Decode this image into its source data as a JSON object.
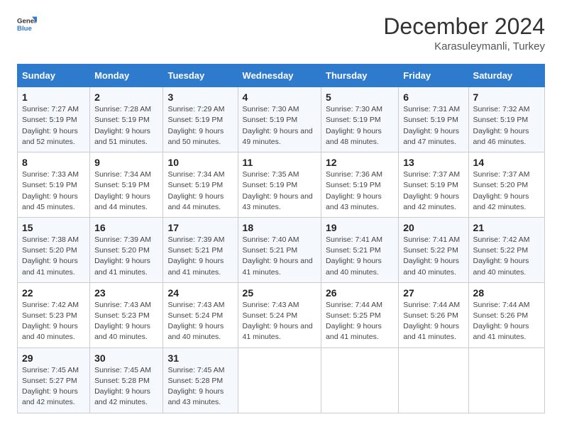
{
  "logo": {
    "general": "General",
    "blue": "Blue"
  },
  "title": "December 2024",
  "subtitle": "Karasuleymanli, Turkey",
  "days_header": [
    "Sunday",
    "Monday",
    "Tuesday",
    "Wednesday",
    "Thursday",
    "Friday",
    "Saturday"
  ],
  "weeks": [
    [
      {
        "day": "1",
        "sunrise": "7:27 AM",
        "sunset": "5:19 PM",
        "daylight": "9 hours and 52 minutes."
      },
      {
        "day": "2",
        "sunrise": "7:28 AM",
        "sunset": "5:19 PM",
        "daylight": "9 hours and 51 minutes."
      },
      {
        "day": "3",
        "sunrise": "7:29 AM",
        "sunset": "5:19 PM",
        "daylight": "9 hours and 50 minutes."
      },
      {
        "day": "4",
        "sunrise": "7:30 AM",
        "sunset": "5:19 PM",
        "daylight": "9 hours and 49 minutes."
      },
      {
        "day": "5",
        "sunrise": "7:30 AM",
        "sunset": "5:19 PM",
        "daylight": "9 hours and 48 minutes."
      },
      {
        "day": "6",
        "sunrise": "7:31 AM",
        "sunset": "5:19 PM",
        "daylight": "9 hours and 47 minutes."
      },
      {
        "day": "7",
        "sunrise": "7:32 AM",
        "sunset": "5:19 PM",
        "daylight": "9 hours and 46 minutes."
      }
    ],
    [
      {
        "day": "8",
        "sunrise": "7:33 AM",
        "sunset": "5:19 PM",
        "daylight": "9 hours and 45 minutes."
      },
      {
        "day": "9",
        "sunrise": "7:34 AM",
        "sunset": "5:19 PM",
        "daylight": "9 hours and 44 minutes."
      },
      {
        "day": "10",
        "sunrise": "7:34 AM",
        "sunset": "5:19 PM",
        "daylight": "9 hours and 44 minutes."
      },
      {
        "day": "11",
        "sunrise": "7:35 AM",
        "sunset": "5:19 PM",
        "daylight": "9 hours and 43 minutes."
      },
      {
        "day": "12",
        "sunrise": "7:36 AM",
        "sunset": "5:19 PM",
        "daylight": "9 hours and 43 minutes."
      },
      {
        "day": "13",
        "sunrise": "7:37 AM",
        "sunset": "5:19 PM",
        "daylight": "9 hours and 42 minutes."
      },
      {
        "day": "14",
        "sunrise": "7:37 AM",
        "sunset": "5:20 PM",
        "daylight": "9 hours and 42 minutes."
      }
    ],
    [
      {
        "day": "15",
        "sunrise": "7:38 AM",
        "sunset": "5:20 PM",
        "daylight": "9 hours and 41 minutes."
      },
      {
        "day": "16",
        "sunrise": "7:39 AM",
        "sunset": "5:20 PM",
        "daylight": "9 hours and 41 minutes."
      },
      {
        "day": "17",
        "sunrise": "7:39 AM",
        "sunset": "5:21 PM",
        "daylight": "9 hours and 41 minutes."
      },
      {
        "day": "18",
        "sunrise": "7:40 AM",
        "sunset": "5:21 PM",
        "daylight": "9 hours and 41 minutes."
      },
      {
        "day": "19",
        "sunrise": "7:41 AM",
        "sunset": "5:21 PM",
        "daylight": "9 hours and 40 minutes."
      },
      {
        "day": "20",
        "sunrise": "7:41 AM",
        "sunset": "5:22 PM",
        "daylight": "9 hours and 40 minutes."
      },
      {
        "day": "21",
        "sunrise": "7:42 AM",
        "sunset": "5:22 PM",
        "daylight": "9 hours and 40 minutes."
      }
    ],
    [
      {
        "day": "22",
        "sunrise": "7:42 AM",
        "sunset": "5:23 PM",
        "daylight": "9 hours and 40 minutes."
      },
      {
        "day": "23",
        "sunrise": "7:43 AM",
        "sunset": "5:23 PM",
        "daylight": "9 hours and 40 minutes."
      },
      {
        "day": "24",
        "sunrise": "7:43 AM",
        "sunset": "5:24 PM",
        "daylight": "9 hours and 40 minutes."
      },
      {
        "day": "25",
        "sunrise": "7:43 AM",
        "sunset": "5:24 PM",
        "daylight": "9 hours and 41 minutes."
      },
      {
        "day": "26",
        "sunrise": "7:44 AM",
        "sunset": "5:25 PM",
        "daylight": "9 hours and 41 minutes."
      },
      {
        "day": "27",
        "sunrise": "7:44 AM",
        "sunset": "5:26 PM",
        "daylight": "9 hours and 41 minutes."
      },
      {
        "day": "28",
        "sunrise": "7:44 AM",
        "sunset": "5:26 PM",
        "daylight": "9 hours and 41 minutes."
      }
    ],
    [
      {
        "day": "29",
        "sunrise": "7:45 AM",
        "sunset": "5:27 PM",
        "daylight": "9 hours and 42 minutes."
      },
      {
        "day": "30",
        "sunrise": "7:45 AM",
        "sunset": "5:28 PM",
        "daylight": "9 hours and 42 minutes."
      },
      {
        "day": "31",
        "sunrise": "7:45 AM",
        "sunset": "5:28 PM",
        "daylight": "9 hours and 43 minutes."
      },
      null,
      null,
      null,
      null
    ]
  ]
}
